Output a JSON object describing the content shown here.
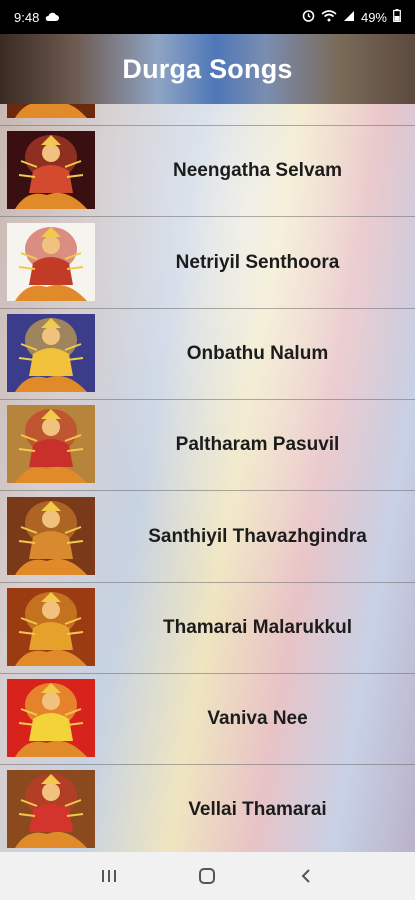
{
  "status_bar": {
    "time": "9:48",
    "battery": "49%",
    "left_icons": [
      "cloud-icon"
    ],
    "right_icons": [
      "alarm-icon",
      "wifi-icon",
      "signal-icon",
      "battery-icon"
    ]
  },
  "header": {
    "title": "Durga Songs",
    "gradient": [
      "#3a2a22",
      "#4f77b8",
      "#5b4a3e"
    ]
  },
  "songs": [
    {
      "title": "",
      "thumb_bg": "#6b2a0e",
      "thumb_accent": "#e3a126",
      "partial": true
    },
    {
      "title": "Neengatha Selvam",
      "thumb_bg": "#3a0f12",
      "thumb_accent": "#d44a2e"
    },
    {
      "title": "Netriyil Senthoora",
      "thumb_bg": "#f6f4ef",
      "thumb_accent": "#c23b27"
    },
    {
      "title": "Onbathu Nalum",
      "thumb_bg": "#3b3c8a",
      "thumb_accent": "#f2c13b"
    },
    {
      "title": "Paltharam Pasuvil",
      "thumb_bg": "#b6843a",
      "thumb_accent": "#c8302a"
    },
    {
      "title": "Santhiyil Thavazhgindra",
      "thumb_bg": "#7a3a1a",
      "thumb_accent": "#d9892e"
    },
    {
      "title": "Thamarai Malarukkul",
      "thumb_bg": "#9b3b12",
      "thumb_accent": "#e6a12a"
    },
    {
      "title": "Vaniva Nee",
      "thumb_bg": "#d8231c",
      "thumb_accent": "#f3d23a"
    },
    {
      "title": "Vellai Thamarai",
      "thumb_bg": "#8a4a1e",
      "thumb_accent": "#d3342c"
    }
  ],
  "nav_bar": {
    "buttons": [
      "recent-apps-icon",
      "home-icon",
      "back-icon"
    ]
  }
}
